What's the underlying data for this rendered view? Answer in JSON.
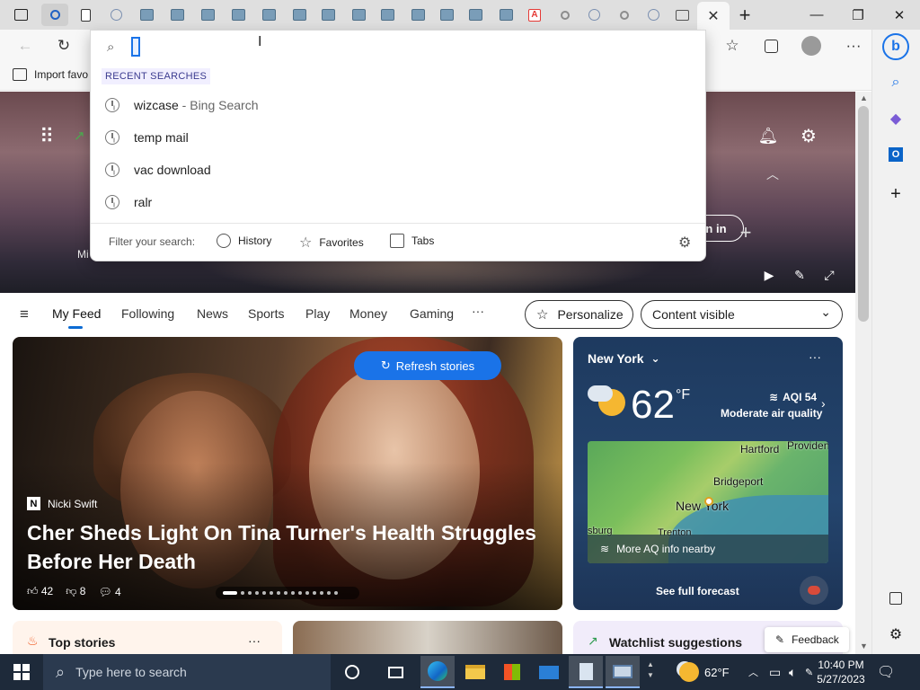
{
  "window": {
    "minimize": "—",
    "restore": "❐",
    "close": "✕",
    "new_tab": "+",
    "close_tab": "✕"
  },
  "tab_strip": {
    "tab_actions_icon": "tab-actions-icon",
    "pdf_glyph": "A"
  },
  "favorites_bar": {
    "import_label": "Import favo"
  },
  "dropdown": {
    "heading": "RECENT SEARCHES",
    "recent": [
      {
        "text": "wizcase",
        "suffix": " - Bing Search"
      },
      {
        "text": "temp mail",
        "suffix": ""
      },
      {
        "text": "vac download",
        "suffix": ""
      },
      {
        "text": "ralr",
        "suffix": ""
      }
    ],
    "filter_label": "Filter your search:",
    "filters": [
      "History",
      "Favorites",
      "Tabs"
    ]
  },
  "hero": {
    "signin_label": "gn in",
    "partial_text": "Mi"
  },
  "nav": {
    "items": [
      "My Feed",
      "Following",
      "News",
      "Sports",
      "Play",
      "Money",
      "Gaming"
    ],
    "more": "···",
    "personalize": "Personalize",
    "content_visible": "Content visible"
  },
  "story": {
    "refresh": "Refresh stories",
    "source": "Nicki Swift",
    "source_logo": "N",
    "headline": "Cher Sheds Light On Tina Turner's Health Struggles Before Her Death",
    "likes": "42",
    "dislikes": "8",
    "comments": "4",
    "carousel_count": 15,
    "carousel_active": 1
  },
  "weather": {
    "city": "New York",
    "temp": "62",
    "unit": "°F",
    "aqi": "AQI 54",
    "aqi_desc": "Moderate air quality",
    "map_labels": [
      "Hartford",
      "Providen",
      "Bridgeport",
      "New York",
      "sburg",
      "Trenton"
    ],
    "aq_more": "More AQ info nearby",
    "forecast": "See full forecast",
    "more": "···"
  },
  "bottom": {
    "top_stories": "Top stories",
    "top_more": "···",
    "watchlist": "Watchlist suggestions",
    "feedback": "Feedback"
  },
  "taskbar": {
    "search_placeholder": "Type here to search",
    "temp": "62°F",
    "time": "10:40 PM",
    "date": "5/27/2023"
  }
}
